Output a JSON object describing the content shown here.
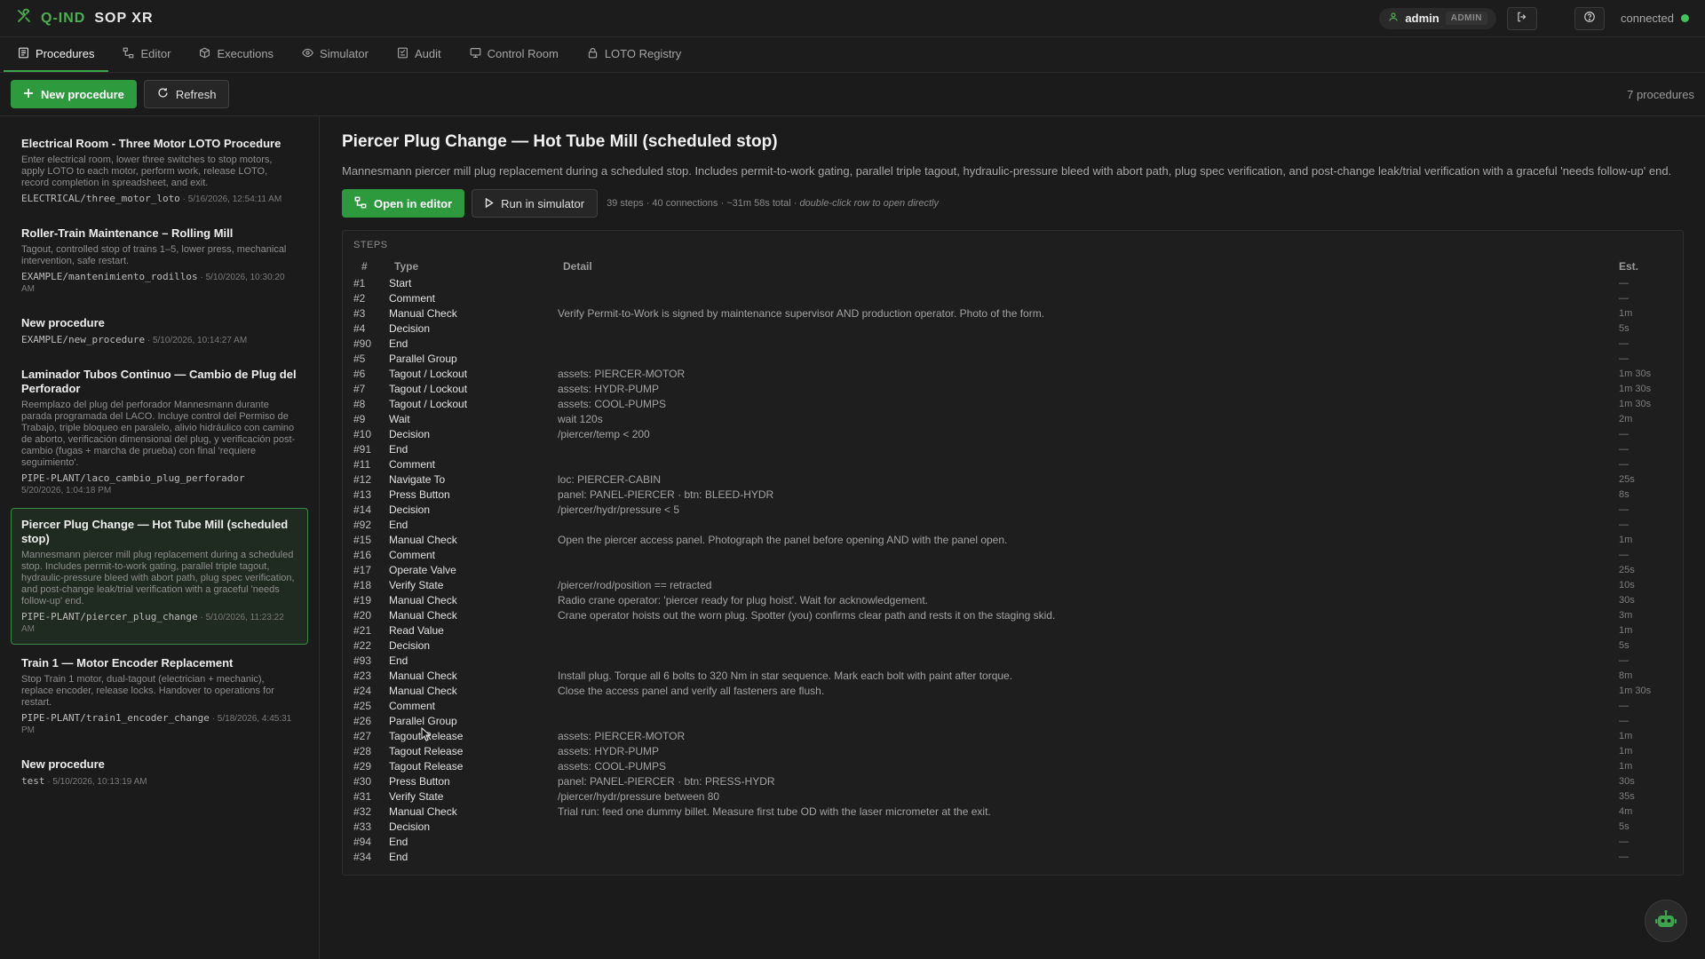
{
  "app": {
    "brand_q": "Q-IND",
    "brand_sop": "SOP XR"
  },
  "user": {
    "name": "admin",
    "role": "ADMIN"
  },
  "connection": {
    "status": "connected"
  },
  "nav": {
    "tabs": [
      {
        "label": "Procedures",
        "icon": "list-icon"
      },
      {
        "label": "Editor",
        "icon": "editor-icon"
      },
      {
        "label": "Executions",
        "icon": "box-icon"
      },
      {
        "label": "Simulator",
        "icon": "eye-icon"
      },
      {
        "label": "Audit",
        "icon": "audit-icon"
      },
      {
        "label": "Control Room",
        "icon": "monitor-icon"
      },
      {
        "label": "LOTO Registry",
        "icon": "lock-icon"
      }
    ]
  },
  "toolbar": {
    "new_label": "New procedure",
    "refresh_label": "Refresh",
    "count": "7 procedures"
  },
  "procedures": [
    {
      "title": "Electrical Room - Three Motor LOTO Procedure",
      "desc": "Enter electrical room, lower three switches to stop motors, apply LOTO to each motor, perform work, release LOTO, record completion in spreadsheet, and exit.",
      "path": "ELECTRICAL/three_motor_loto",
      "date": " · 5/16/2026, 12:54:11 AM"
    },
    {
      "title": "Roller-Train Maintenance – Rolling Mill",
      "desc": "Tagout, controlled stop of trains 1–5, lower press, mechanical intervention, safe restart.",
      "path": "EXAMPLE/mantenimiento_rodillos",
      "date": " · 5/10/2026, 10:30:20 AM"
    },
    {
      "title": "New procedure",
      "desc": "",
      "path": "EXAMPLE/new_procedure",
      "date": " · 5/10/2026, 10:14:27 AM"
    },
    {
      "title": "Laminador Tubos Continuo — Cambio de Plug del Perforador",
      "desc": "Reemplazo del plug del perforador Mannesmann durante parada programada del LACO. Incluye control del Permiso de Trabajo, triple bloqueo en paralelo, alivio hidráulico con camino de aborto, verificación dimensional del plug, y verificación post-cambio (fugas + marcha de prueba) con final 'requiere seguimiento'.",
      "path": "PIPE-PLANT/laco_cambio_plug_perforador",
      "date": "5/20/2026, 1:04:18 PM"
    },
    {
      "title": "Piercer Plug Change — Hot Tube Mill (scheduled stop)",
      "desc": "Mannesmann piercer mill plug replacement during a scheduled stop. Includes permit-to-work gating, parallel triple tagout, hydraulic-pressure bleed with abort path, plug spec verification, and post-change leak/trial verification with a graceful 'needs follow-up' end.",
      "path": "PIPE-PLANT/piercer_plug_change",
      "date": " · 5/10/2026, 11:23:22 AM"
    },
    {
      "title": "Train 1 — Motor Encoder Replacement",
      "desc": "Stop Train 1 motor, dual-tagout (electrician + mechanic), replace encoder, release locks. Handover to operations for restart.",
      "path": "PIPE-PLANT/train1_encoder_change",
      "date": " · 5/18/2026, 4:45:31 PM"
    },
    {
      "title": "New procedure",
      "desc": "",
      "path": "test",
      "date": " · 5/10/2026, 10:13:19 AM"
    }
  ],
  "detail": {
    "title": "Piercer Plug Change — Hot Tube Mill (scheduled stop)",
    "desc": "Mannesmann piercer mill plug replacement during a scheduled stop. Includes permit-to-work gating, parallel triple tagout, hydraulic-pressure bleed with abort path, plug spec verification, and post-change leak/trial verification with a graceful 'needs follow-up' end.",
    "open_label": "Open in editor",
    "run_label": "Run in simulator",
    "stats": "39 steps · 40 connections · ~31m 58s total · ",
    "hint": "double-click row to open directly",
    "steps_caption": "STEPS",
    "columns": {
      "num": "#",
      "type": "Type",
      "detail": "Detail",
      "est": "Est."
    },
    "steps": [
      {
        "num": "#1",
        "type": "Start",
        "detail": "",
        "est": "—"
      },
      {
        "num": "#2",
        "type": "Comment",
        "detail": "",
        "est": "—"
      },
      {
        "num": "#3",
        "type": "Manual Check",
        "detail": "Verify Permit-to-Work is signed by maintenance supervisor AND production operator. Photo of the form.",
        "est": "1m"
      },
      {
        "num": "#4",
        "type": "Decision",
        "detail": "",
        "est": "5s"
      },
      {
        "num": "#90",
        "type": "End",
        "detail": "",
        "est": "—"
      },
      {
        "num": "#5",
        "type": "Parallel Group",
        "detail": "",
        "est": "—"
      },
      {
        "num": "#6",
        "type": "Tagout / Lockout",
        "detail": "assets: PIERCER-MOTOR",
        "est": "1m 30s"
      },
      {
        "num": "#7",
        "type": "Tagout / Lockout",
        "detail": "assets: HYDR-PUMP",
        "est": "1m 30s"
      },
      {
        "num": "#8",
        "type": "Tagout / Lockout",
        "detail": "assets: COOL-PUMPS",
        "est": "1m 30s"
      },
      {
        "num": "#9",
        "type": "Wait",
        "detail": "wait 120s",
        "est": "2m"
      },
      {
        "num": "#10",
        "type": "Decision",
        "detail": "/piercer/temp < 200",
        "est": "—"
      },
      {
        "num": "#91",
        "type": "End",
        "detail": "",
        "est": "—"
      },
      {
        "num": "#11",
        "type": "Comment",
        "detail": "",
        "est": "—"
      },
      {
        "num": "#12",
        "type": "Navigate To",
        "detail": "loc: PIERCER-CABIN",
        "est": "25s"
      },
      {
        "num": "#13",
        "type": "Press Button",
        "detail": "panel: PANEL-PIERCER · btn: BLEED-HYDR",
        "est": "8s"
      },
      {
        "num": "#14",
        "type": "Decision",
        "detail": "/piercer/hydr/pressure < 5",
        "est": "—"
      },
      {
        "num": "#92",
        "type": "End",
        "detail": "",
        "est": "—"
      },
      {
        "num": "#15",
        "type": "Manual Check",
        "detail": "Open the piercer access panel. Photograph the panel before opening AND with the panel open.",
        "est": "1m"
      },
      {
        "num": "#16",
        "type": "Comment",
        "detail": "",
        "est": "—"
      },
      {
        "num": "#17",
        "type": "Operate Valve",
        "detail": "",
        "est": "25s"
      },
      {
        "num": "#18",
        "type": "Verify State",
        "detail": "/piercer/rod/position == retracted",
        "est": "10s"
      },
      {
        "num": "#19",
        "type": "Manual Check",
        "detail": "Radio crane operator: 'piercer ready for plug hoist'. Wait for acknowledgement.",
        "est": "30s"
      },
      {
        "num": "#20",
        "type": "Manual Check",
        "detail": "Crane operator hoists out the worn plug. Spotter (you) confirms clear path and rests it on the staging skid.",
        "est": "3m"
      },
      {
        "num": "#21",
        "type": "Read Value",
        "detail": "",
        "est": "1m"
      },
      {
        "num": "#22",
        "type": "Decision",
        "detail": "",
        "est": "5s"
      },
      {
        "num": "#93",
        "type": "End",
        "detail": "",
        "est": "—"
      },
      {
        "num": "#23",
        "type": "Manual Check",
        "detail": "Install plug. Torque all 6 bolts to 320 Nm in star sequence. Mark each bolt with paint after torque.",
        "est": "8m"
      },
      {
        "num": "#24",
        "type": "Manual Check",
        "detail": "Close the access panel and verify all fasteners are flush.",
        "est": "1m 30s"
      },
      {
        "num": "#25",
        "type": "Comment",
        "detail": "",
        "est": "—"
      },
      {
        "num": "#26",
        "type": "Parallel Group",
        "detail": "",
        "est": "—"
      },
      {
        "num": "#27",
        "type": "Tagout Release",
        "detail": "assets: PIERCER-MOTOR",
        "est": "1m"
      },
      {
        "num": "#28",
        "type": "Tagout Release",
        "detail": "assets: HYDR-PUMP",
        "est": "1m"
      },
      {
        "num": "#29",
        "type": "Tagout Release",
        "detail": "assets: COOL-PUMPS",
        "est": "1m"
      },
      {
        "num": "#30",
        "type": "Press Button",
        "detail": "panel: PANEL-PIERCER · btn: PRESS-HYDR",
        "est": "30s"
      },
      {
        "num": "#31",
        "type": "Verify State",
        "detail": "/piercer/hydr/pressure between 80",
        "est": "35s"
      },
      {
        "num": "#32",
        "type": "Manual Check",
        "detail": "Trial run: feed one dummy billet. Measure first tube OD with the laser micrometer at the exit.",
        "est": "4m"
      },
      {
        "num": "#33",
        "type": "Decision",
        "detail": "",
        "est": "5s"
      },
      {
        "num": "#94",
        "type": "End",
        "detail": "",
        "est": "—"
      },
      {
        "num": "#34",
        "type": "End",
        "detail": "",
        "est": "—"
      }
    ]
  },
  "colors": {
    "accent": "#2e9a3e",
    "background": "#1b1b1b",
    "connected": "#43c15a"
  }
}
